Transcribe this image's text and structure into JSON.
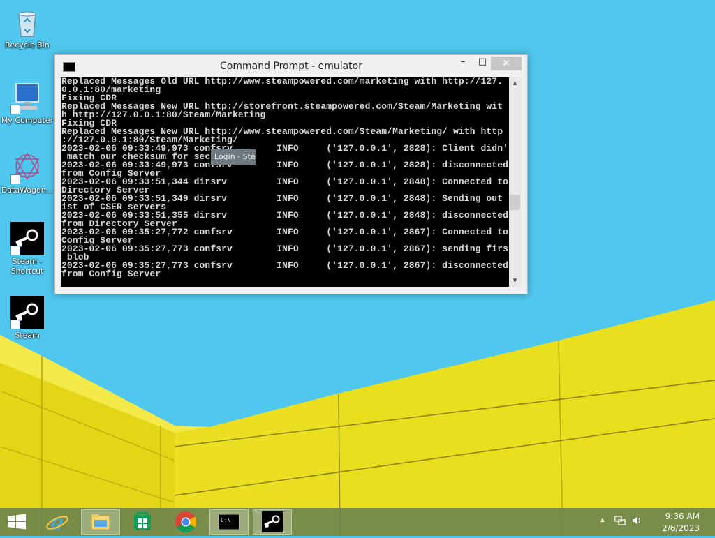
{
  "desktop": {
    "icons": [
      {
        "label": "Recycle Bin"
      },
      {
        "label": "My Computer"
      },
      {
        "label": "DataWagon..."
      },
      {
        "label": "Steam -\nShortcut"
      },
      {
        "label": "Steam"
      }
    ]
  },
  "window": {
    "title": "Command Prompt - emulator",
    "minimize": "–",
    "maximize": "□",
    "close": "✕",
    "console_text": "Replaced Messages Old URL http://www.steampowered.com/marketing with http://127.\n0.0.1:80/marketing\nFixing CDR\nReplaced Messages New URL http://storefront.steampowered.com/Steam/Marketing wit\nh http://127.0.0.1:80/Steam/Marketing\nFixing CDR\nReplaced Messages New URL http://www.steampowered.com/Steam/Marketing/ with http\n://127.0.0.1:80/Steam/Marketing/\n2023-02-06 09:33:49,973 confsrv        INFO     ('127.0.0.1', 2828): Client didn't\n match our checksum for secret\n2023-02-06 09:33:49,973 confsrv        INFO     ('127.0.0.1', 2828): disconnected\nfrom Config Server\n2023-02-06 09:33:51,344 dirsrv         INFO     ('127.0.0.1', 2848): Connected to\nDirectory Server\n2023-02-06 09:33:51,349 dirsrv         INFO     ('127.0.0.1', 2848): Sending out l\nist of CSER servers\n2023-02-06 09:33:51,355 dirsrv         INFO     ('127.0.0.1', 2848): disconnected\nfrom Directory Server\n2023-02-06 09:35:27,772 confsrv        INFO     ('127.0.0.1', 2867): Connected to\nConfig Server\n2023-02-06 09:35:27,773 confsrv        INFO     ('127.0.0.1', 2867): sending first\n blob\n2023-02-06 09:35:27,773 confsrv        INFO     ('127.0.0.1', 2867): disconnected\nfrom Config Server"
  },
  "tooltip": "Login - Steam",
  "taskbar": {
    "apps": [
      {
        "icon": "start-icon"
      },
      {
        "icon": "internet-explorer-icon"
      },
      {
        "icon": "file-explorer-icon"
      },
      {
        "icon": "store-icon"
      },
      {
        "icon": "chrome-icon"
      },
      {
        "icon": "command-prompt-icon"
      },
      {
        "icon": "steam-icon"
      }
    ],
    "tray": {
      "time": "9:36 AM",
      "date": "2/6/2023"
    }
  },
  "colors": {
    "sky": "#4cc6ee",
    "wall": "#e9dc1c",
    "console_bg": "#000000",
    "console_fg": "#d6d6d6"
  }
}
